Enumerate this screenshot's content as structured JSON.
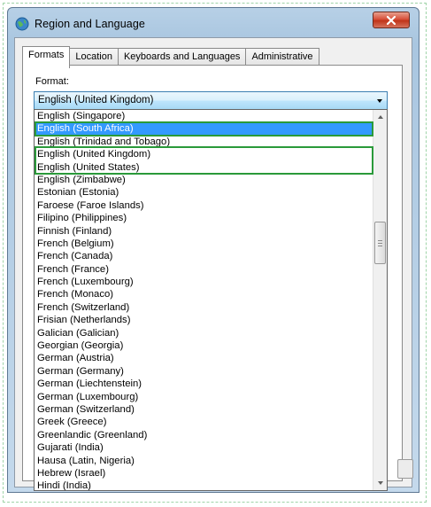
{
  "window": {
    "title": "Region and Language",
    "close_label": "✕"
  },
  "tabs": [
    {
      "label": "Formats",
      "active": true
    },
    {
      "label": "Location",
      "active": false
    },
    {
      "label": "Keyboards and Languages",
      "active": false
    },
    {
      "label": "Administrative",
      "active": false
    }
  ],
  "format": {
    "label": "Format:",
    "selected_value": "English (United Kingdom)"
  },
  "dropdown": {
    "items": [
      "English (Singapore)",
      "English (South Africa)",
      "English (Trinidad and Tobago)",
      "English (United Kingdom)",
      "English (United States)",
      "English (Zimbabwe)",
      "Estonian (Estonia)",
      "Faroese (Faroe Islands)",
      "Filipino (Philippines)",
      "Finnish (Finland)",
      "French (Belgium)",
      "French (Canada)",
      "French (France)",
      "French (Luxembourg)",
      "French (Monaco)",
      "French (Switzerland)",
      "Frisian (Netherlands)",
      "Galician (Galician)",
      "Georgian (Georgia)",
      "German (Austria)",
      "German (Germany)",
      "German (Liechtenstein)",
      "German (Luxembourg)",
      "German (Switzerland)",
      "Greek (Greece)",
      "Greenlandic (Greenland)",
      "Gujarati (India)",
      "Hausa (Latin, Nigeria)",
      "Hebrew (Israel)",
      "Hindi (India)"
    ],
    "highlighted_item": "English (South Africa)"
  },
  "colors": {
    "selection": "#3399ff",
    "annotation_box": "#2a9a3a"
  },
  "icons": {
    "app": "globe-icon",
    "close": "close-icon",
    "dropdown_arrow": "chevron-down-icon"
  }
}
